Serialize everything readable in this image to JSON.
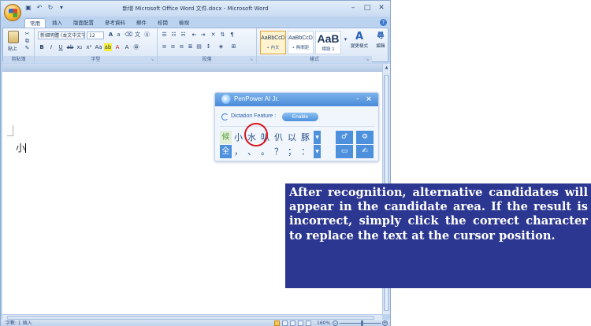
{
  "window": {
    "title": "新增 Microsoft Office Word 文件.docx - Microsoft Word",
    "minimize_glyph": "–",
    "maximize_glyph": "□",
    "close_glyph": "✕"
  },
  "ribbon": {
    "tabs": [
      "常用",
      "插入",
      "版面配置",
      "參考資料",
      "郵件",
      "校閱",
      "檢視"
    ],
    "active_tab": "常用",
    "font_name": "新細明體 (本文中文字)",
    "font_size": "12",
    "groups": [
      "剪貼簿",
      "字型",
      "段落",
      "樣式"
    ],
    "paste_label": "貼上",
    "styles": [
      {
        "sample": "AaBbCcD",
        "name": "• 內文"
      },
      {
        "sample": "AaBbCcD",
        "name": "• 無間距"
      },
      {
        "sample": "AaB",
        "name": "標題 1"
      }
    ],
    "change_styles_label": "變更樣式",
    "edit_label": "編輯"
  },
  "document": {
    "text": "小"
  },
  "statusbar": {
    "left": "字數: 1    插入",
    "zoom": "160%"
  },
  "penpower": {
    "title": "PenPower AI Jr.",
    "dictation_label": "Dictation Feature :",
    "enable_label": "Enable",
    "row1_tag": "候",
    "row1_candidates": [
      "小",
      "水",
      "叭",
      "仈",
      "以",
      "豚"
    ],
    "row2_tag": "全",
    "row2_symbols": [
      "，",
      "、",
      "。",
      "？",
      "；",
      "："
    ],
    "selected_candidate": "水"
  },
  "caption": {
    "text": "After recognition, alternative candidates will appear in the candidate area. If the result is incorrect, simply click the correct character to replace the text at the cursor position."
  }
}
